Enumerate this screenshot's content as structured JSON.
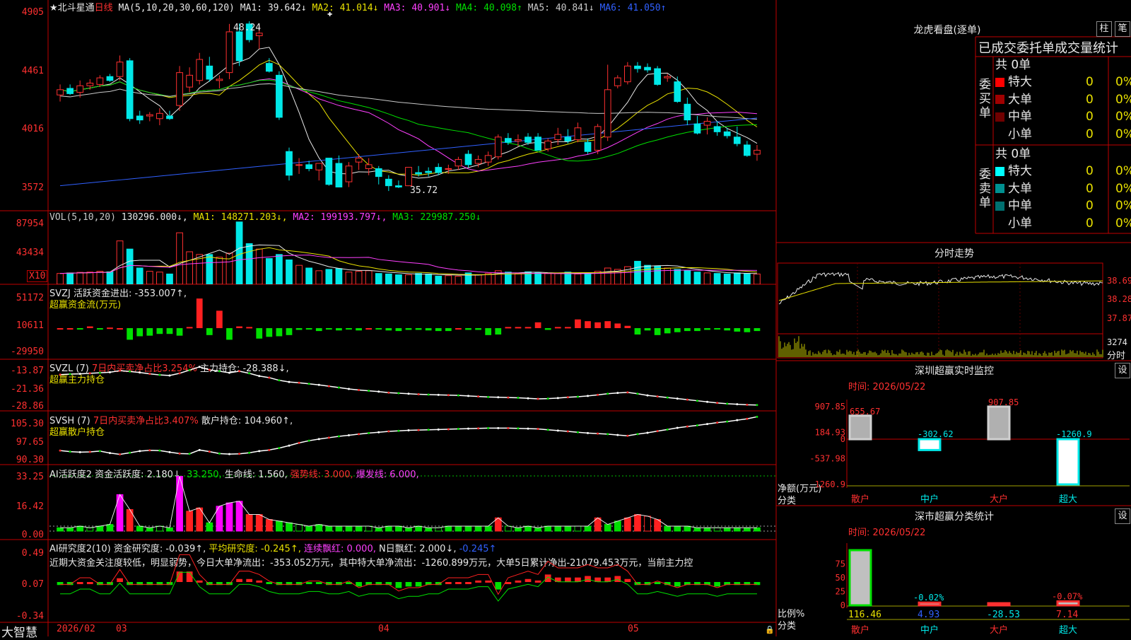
{
  "chart_title": {
    "stock": "★北斗星通",
    "period": "日线",
    "ma_spec": "MA(5,10,20,30,60,120)",
    "ma_values": [
      {
        "label": "MA1: 39.642↓",
        "color": "#e8e8e8"
      },
      {
        "label": "MA2: 41.014↓",
        "color": "#e8e000"
      },
      {
        "label": "MA3: 40.901↓",
        "color": "#ff40ff"
      },
      {
        "label": "MA4: 40.098↑",
        "color": "#00e000"
      },
      {
        "label": "MA5: 40.841↓",
        "color": "#c8c8c8"
      },
      {
        "label": "MA6: 41.050↑",
        "color": "#3060ff"
      }
    ]
  },
  "price_panel": {
    "y_labels": [
      "4905",
      "4461",
      "4016",
      "3572"
    ],
    "high_label": "48.24",
    "low_label": "35.72",
    "ticks": [
      49.05,
      44.61,
      40.16,
      35.72
    ]
  },
  "vol_panel": {
    "y_labels": [
      "87954",
      "43434"
    ],
    "unit": "X10",
    "legend": [
      {
        "label": "VOL(5,10,20)",
        "color": "#c8c8c8"
      },
      {
        "label": "130296.000↓,",
        "color": "#e8e8e8"
      },
      {
        "label": "MA1: 148271.203↓,",
        "color": "#e8e000"
      },
      {
        "label": "MA2: 199193.797↓,",
        "color": "#ff40ff"
      },
      {
        "label": "MA3: 229987.250↓",
        "color": "#00e000"
      }
    ]
  },
  "svzj_panel": {
    "y_labels": [
      "51172",
      "10611",
      "-29950"
    ],
    "legend1": "SVZJ  活跃资金进出: -353.007↑,",
    "legend2": "超赢资金流(万元)"
  },
  "svzl_panel": {
    "y_labels": [
      "-13.87",
      "-21.36",
      "-28.86"
    ],
    "legend_a": "SVZL (7)",
    "legend_b": "7日内买卖净占比3.254%",
    "legend_c": "主力持仓: -28.388↓,",
    "legend2": "超赢主力持仓"
  },
  "svsh_panel": {
    "y_labels": [
      "105.30",
      "97.65",
      "90.30"
    ],
    "legend_a": "SVSH (7)",
    "legend_b": "7日内买卖净占比3.407%",
    "legend_c": "散户持仓: 104.960↑,",
    "legend2": "超赢散户持仓"
  },
  "ai_active_panel": {
    "y_labels": [
      "33.25",
      "16.42",
      "0.00"
    ],
    "legend": [
      {
        "label": "AI活跃度2 资金活跃度: 2.180↓,",
        "color": "#e8e8e8"
      },
      {
        "label": "33.250,",
        "color": "#00e000"
      },
      {
        "label": "生命线: 1.560,",
        "color": "#e8e8e8"
      },
      {
        "label": "强势线: 3.000,",
        "color": "#ff3030"
      },
      {
        "label": "爆发线: 6.000,",
        "color": "#ff40ff"
      }
    ]
  },
  "ai_research_panel": {
    "y_labels": [
      "0.49",
      "0.07",
      "-0.34"
    ],
    "legend": [
      {
        "label": "AI研究度2(10) 资金研究度: -0.039↑,",
        "color": "#e8e8e8"
      },
      {
        "label": "平均研究度: -0.245↑,",
        "color": "#e8e000"
      },
      {
        "label": "连续飘红: 0.000,",
        "color": "#ff40ff"
      },
      {
        "label": "N日飘红: 2.000↓,",
        "color": "#e8e8e8"
      },
      {
        "label": "-0.245↑",
        "color": "#3060ff"
      }
    ],
    "note": "近期大资金关注度较低，明显弱势，今日大单净流出：-353.052万元，其中特大单净流出：-1260.899万元，大单5日累计净出-21079.453万元，当前主力控"
  },
  "x_axis": {
    "brand": "大智慧",
    "labels": [
      "2026/02",
      "03",
      "04",
      "05"
    ]
  },
  "dragon_tiger": {
    "title": "龙虎看盘(逐单)",
    "btn1": "柱",
    "btn2": "笔",
    "subtitle": "已成交委托单成交量统计",
    "buy_label": "委买单",
    "sell_label": "委卖单",
    "buy_total": "共 0单",
    "sell_total": "共 0单",
    "buy_rows": [
      {
        "name": "特大",
        "count": "0",
        "pct": "0%",
        "color": "#ff0000"
      },
      {
        "name": "大单",
        "count": "0",
        "pct": "0%",
        "color": "#a00000"
      },
      {
        "name": "中单",
        "count": "0",
        "pct": "0%",
        "color": "#700000"
      },
      {
        "name": "小单",
        "count": "0",
        "pct": "0%",
        "color": ""
      }
    ],
    "sell_rows": [
      {
        "name": "特大",
        "count": "0",
        "pct": "0%",
        "color": "#00ffff"
      },
      {
        "name": "大单",
        "count": "0",
        "pct": "0%",
        "color": "#009090"
      },
      {
        "name": "中单",
        "count": "0",
        "pct": "0%",
        "color": "#007070"
      },
      {
        "name": "小单",
        "count": "0",
        "pct": "0%",
        "color": ""
      }
    ]
  },
  "intraday": {
    "title": "分时走势",
    "prices": [
      "38.69",
      "38.28",
      "37.87"
    ],
    "vol_label": "3274",
    "time_label": "分时"
  },
  "sz_monitor": {
    "title": "深圳超赢实时监控",
    "btn": "设",
    "time": "时间: 2026/05/22",
    "y_labels": [
      "907.85",
      "184.93",
      "0",
      "-537.98",
      "-1260.9"
    ],
    "unit1": "净额(万元)",
    "unit2": "分类",
    "bars": [
      {
        "cat": "散户",
        "value": 655.67,
        "label": "655.67"
      },
      {
        "cat": "中户",
        "value": -302.62,
        "label": "-302.62"
      },
      {
        "cat": "大户",
        "value": 907.85,
        "label": "907.85"
      },
      {
        "cat": "超大",
        "value": -1260.9,
        "label": "-1260.9"
      }
    ]
  },
  "sz_class": {
    "title": "深市超赢分类统计",
    "btn": "设",
    "time": "时间: 2026/05/22",
    "y_labels": [
      "75",
      "50",
      "25",
      "0"
    ],
    "unit1": "比例%",
    "unit2": "分类",
    "bars": [
      {
        "cat": "散户",
        "value": 116.46,
        "label": "116.46",
        "top_label": ""
      },
      {
        "cat": "中户",
        "value": 4.93,
        "label": "4.93",
        "top_label": "-0.02%"
      },
      {
        "cat": "大户",
        "value": -28.53,
        "label": "-28.53",
        "top_label": ""
      },
      {
        "cat": "超大",
        "value": 7.14,
        "label": "7.14",
        "top_label": "-0.07%"
      }
    ]
  },
  "chart_data": {
    "type": "candlestick",
    "y_range": [
      35.72,
      49.05
    ],
    "candles": [
      [
        42.8,
        43.6,
        42.3,
        43.2
      ],
      [
        43.3,
        43.6,
        42.8,
        42.9
      ],
      [
        43.0,
        43.9,
        42.6,
        43.5
      ],
      [
        43.5,
        44.0,
        43.2,
        43.7
      ],
      [
        43.6,
        44.3,
        43.4,
        44.1
      ],
      [
        44.2,
        44.4,
        43.8,
        43.9
      ],
      [
        44.2,
        45.8,
        43.9,
        45.3
      ],
      [
        45.4,
        45.6,
        40.8,
        41.0
      ],
      [
        41.2,
        41.6,
        40.6,
        40.9
      ],
      [
        41.2,
        41.5,
        40.8,
        41.3
      ],
      [
        41.0,
        41.8,
        40.5,
        41.4
      ],
      [
        41.2,
        41.6,
        40.9,
        41.0
      ],
      [
        42.0,
        45.0,
        41.6,
        44.5
      ],
      [
        43.4,
        44.9,
        43.0,
        44.3
      ],
      [
        43.9,
        46.0,
        43.6,
        45.5
      ],
      [
        45.0,
        45.7,
        43.8,
        44.0
      ],
      [
        43.9,
        44.3,
        43.3,
        44.0
      ],
      [
        44.5,
        48.2,
        44.0,
        47.6
      ],
      [
        47.6,
        48.24,
        45.0,
        45.4
      ],
      [
        48.2,
        48.4,
        46.8,
        47.0
      ],
      [
        47.3,
        48.1,
        46.3,
        47.5
      ],
      [
        45.2,
        45.6,
        44.5,
        44.6
      ],
      [
        44.3,
        44.6,
        40.9,
        41.1
      ],
      [
        38.5,
        38.8,
        36.3,
        36.7
      ],
      [
        37.5,
        38.0,
        36.8,
        37.5
      ],
      [
        37.5,
        37.8,
        37.0,
        37.2
      ],
      [
        37.1,
        37.6,
        36.3,
        37.6
      ],
      [
        38.0,
        38.0,
        35.9,
        36.0
      ],
      [
        37.6,
        38.2,
        35.8,
        35.8
      ],
      [
        36.2,
        37.7,
        35.8,
        37.4
      ],
      [
        37.7,
        38.3,
        37.1,
        38.0
      ],
      [
        37.2,
        38.0,
        36.7,
        37.5
      ],
      [
        37.2,
        37.4,
        36.0,
        36.6
      ],
      [
        36.4,
        36.7,
        35.5,
        35.9
      ],
      [
        35.9,
        36.3,
        35.72,
        35.8
      ],
      [
        35.9,
        37.2,
        35.9,
        37.3
      ],
      [
        36.9,
        37.4,
        36.6,
        36.8
      ],
      [
        37.0,
        37.3,
        36.6,
        36.9
      ],
      [
        37.3,
        37.6,
        36.7,
        36.9
      ],
      [
        37.2,
        37.5,
        36.8,
        37.2
      ],
      [
        37.4,
        38.1,
        37.1,
        37.9
      ],
      [
        38.3,
        38.6,
        37.3,
        37.5
      ],
      [
        37.6,
        38.2,
        37.3,
        37.9
      ],
      [
        37.7,
        38.5,
        37.4,
        38.2
      ],
      [
        38.1,
        39.8,
        37.9,
        39.6
      ],
      [
        39.5,
        39.9,
        39.0,
        39.2
      ],
      [
        39.3,
        39.8,
        38.9,
        39.4
      ],
      [
        39.6,
        39.9,
        39.0,
        39.2
      ],
      [
        39.6,
        39.9,
        38.6,
        38.6
      ],
      [
        38.7,
        39.5,
        38.5,
        39.3
      ],
      [
        39.4,
        40.3,
        39.0,
        39.8
      ],
      [
        39.6,
        40.2,
        39.1,
        39.3
      ],
      [
        39.4,
        40.7,
        39.2,
        40.3
      ],
      [
        39.2,
        39.5,
        38.3,
        38.5
      ],
      [
        38.6,
        40.6,
        38.3,
        40.4
      ],
      [
        39.6,
        45.1,
        39.3,
        43.2
      ],
      [
        43.5,
        44.3,
        43.3,
        44.1
      ],
      [
        43.8,
        45.3,
        43.6,
        45.0
      ],
      [
        45.0,
        45.3,
        44.5,
        44.8
      ],
      [
        44.9,
        45.2,
        44.5,
        44.7
      ],
      [
        44.8,
        45.0,
        43.5,
        43.6
      ],
      [
        44.1,
        44.4,
        43.8,
        44.2
      ],
      [
        43.8,
        44.2,
        42.2,
        42.3
      ],
      [
        42.1,
        42.6,
        40.5,
        40.9
      ],
      [
        40.6,
        41.2,
        39.8,
        39.9
      ],
      [
        40.5,
        41.1,
        39.8,
        40.8
      ],
      [
        40.4,
        40.8,
        39.7,
        40.0
      ],
      [
        40.0,
        40.3,
        39.5,
        39.7
      ],
      [
        39.6,
        40.4,
        38.9,
        39.1
      ],
      [
        39.0,
        39.3,
        38.1,
        38.2
      ],
      [
        38.3,
        39.0,
        37.8,
        38.6
      ]
    ],
    "volume": [
      40,
      42,
      44,
      45,
      48,
      46,
      160,
      130,
      60,
      48,
      45,
      38,
      190,
      120,
      110,
      110,
      100,
      115,
      230,
      150,
      130,
      95,
      110,
      90,
      70,
      60,
      50,
      55,
      58,
      45,
      48,
      50,
      40,
      38,
      35,
      35,
      40,
      38,
      30,
      32,
      30,
      42,
      35,
      40,
      50,
      45,
      40,
      46,
      43,
      40,
      40,
      45,
      38,
      42,
      48,
      60,
      55,
      65,
      85,
      70,
      68,
      60,
      55,
      50,
      45,
      42,
      40,
      38,
      42,
      40,
      38
    ],
    "fund_flow": [
      0,
      0,
      -2,
      3,
      -2,
      1,
      0,
      -20,
      -14,
      -13,
      -10,
      -10,
      -13,
      2,
      51,
      -12,
      30,
      -20,
      3,
      2,
      -18,
      -15,
      -14,
      -12,
      -3,
      -2,
      -5,
      -2,
      -4,
      -2,
      -4,
      0,
      -2,
      -4,
      -5,
      -3,
      -3,
      -4,
      -5,
      -5,
      0,
      -3,
      -3,
      -12,
      -11,
      2,
      2,
      2,
      10,
      -3,
      2,
      2,
      15,
      12,
      10,
      12,
      8,
      4,
      -11,
      -4,
      -12,
      -9,
      -7,
      -5,
      -5,
      -3,
      -2,
      -4,
      -6,
      -7,
      -5
    ],
    "svzl": [
      -17.5,
      -17.3,
      -17.2,
      -17.0,
      -16.8,
      -16.6,
      -16.0,
      -16.3,
      -16.7,
      -17.2,
      -17.6,
      -17.8,
      -17.0,
      -15.8,
      -14.6,
      -15.7,
      -16.2,
      -16.8,
      -16.2,
      -17.0,
      -18.0,
      -18.6,
      -19.6,
      -20.2,
      -20.5,
      -20.9,
      -21.3,
      -21.8,
      -22.3,
      -22.8,
      -23.2,
      -23.5,
      -23.8,
      -24.2,
      -24.4,
      -24.6,
      -24.8,
      -24.9,
      -25.0,
      -25.1,
      -25.2,
      -25.4,
      -25.6,
      -25.8,
      -25.9,
      -26.0,
      -26.1,
      -26.3,
      -26.5,
      -26.4,
      -26.2,
      -25.9,
      -25.7,
      -25.4,
      -25.0,
      -24.6,
      -24.3,
      -24.1,
      -24.6,
      -25.2,
      -25.6,
      -26.0,
      -26.4,
      -26.8,
      -27.2,
      -27.6,
      -28.0,
      -28.3,
      -28.5,
      -28.7,
      -28.8
    ],
    "svsh": [
      92.6,
      92.2,
      92.0,
      92.1,
      92.4,
      91.7,
      91.2,
      91.8,
      92.4,
      92.7,
      92.6,
      92.0,
      91.5,
      91.4,
      92.8,
      92.2,
      91.5,
      91.3,
      91.4,
      91.8,
      92.4,
      92.8,
      93.5,
      94.4,
      95.4,
      96.2,
      96.8,
      97.3,
      97.8,
      98.2,
      98.6,
      99.0,
      99.3,
      99.6,
      99.8,
      100.0,
      100.1,
      100.2,
      100.3,
      100.4,
      100.5,
      100.6,
      100.7,
      100.8,
      100.8,
      100.8,
      100.7,
      100.6,
      100.5,
      100.2,
      99.9,
      99.6,
      99.3,
      99.0,
      98.8,
      98.6,
      98.3,
      98.0,
      98.6,
      99.1,
      99.7,
      100.3,
      100.9,
      101.4,
      101.8,
      102.3,
      102.8,
      103.2,
      103.7,
      104.2,
      104.96
    ],
    "ai_active": [
      2,
      2,
      3,
      2,
      3,
      4,
      22,
      13,
      3,
      2,
      3,
      2,
      33,
      12,
      14,
      5,
      15,
      17,
      18,
      10,
      10,
      7,
      6,
      5,
      4,
      3,
      4,
      3,
      3,
      3,
      3,
      3,
      2,
      3,
      3,
      2,
      3,
      2,
      2,
      3,
      3,
      3,
      3,
      3,
      8,
      3,
      2,
      3,
      2,
      3,
      3,
      3,
      3,
      3,
      8,
      4,
      6,
      8,
      10,
      9,
      7,
      3,
      3,
      3,
      2,
      2,
      2,
      2,
      2,
      2,
      2
    ],
    "ai_research": [
      -0.04,
      -0.04,
      0.0,
      0.0,
      -0.04,
      -0.04,
      0.05,
      -0.04,
      -0.04,
      -0.04,
      -0.04,
      -0.04,
      0.14,
      0.14,
      0.02,
      -0.04,
      -0.04,
      -0.04,
      0.04,
      0.04,
      0.02,
      -0.02,
      -0.04,
      -0.04,
      -0.04,
      -0.02,
      -0.02,
      -0.04,
      -0.04,
      -0.02,
      -0.06,
      -0.04,
      -0.04,
      -0.04,
      -0.08,
      -0.06,
      -0.06,
      -0.04,
      -0.04,
      0.0,
      0.0,
      0.0,
      0.02,
      0.02,
      -0.1,
      0.0,
      0.02,
      0.04,
      0.02,
      0.1,
      0.06,
      0.06,
      0.06,
      0.08,
      0.06,
      0.06,
      0.08,
      0.04,
      -0.04,
      -0.04,
      -0.02,
      -0.04,
      -0.06,
      -0.04,
      -0.04,
      -0.04,
      -0.06,
      -0.04,
      -0.04,
      -0.04,
      -0.04
    ]
  }
}
